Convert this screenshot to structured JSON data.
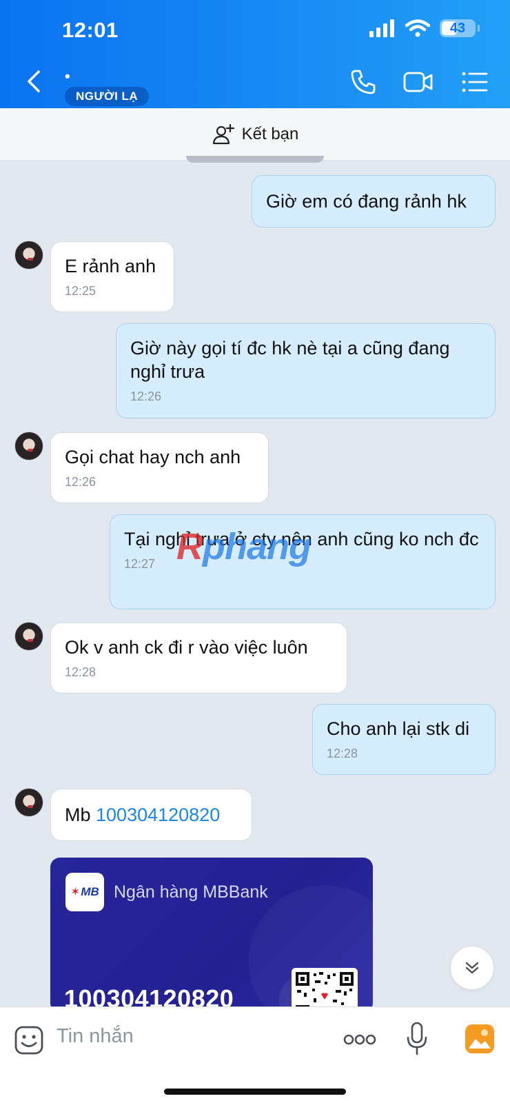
{
  "status_bar": {
    "time": "12:01",
    "battery": "43"
  },
  "header": {
    "contact_name": "•",
    "badge": "NGƯỜI LẠ"
  },
  "add_friend": {
    "label": "Kết bạn"
  },
  "messages": [
    {
      "side": "out",
      "text": "Giờ em có đang rảnh hk",
      "time": ""
    },
    {
      "side": "in",
      "text": "E rảnh anh",
      "time": "12:25"
    },
    {
      "side": "out",
      "text": "Giờ này gọi tí đc hk nè tại a cũng đang nghỉ trưa",
      "time": "12:26"
    },
    {
      "side": "in",
      "text": "Gọi chat hay nch anh",
      "time": "12:26"
    },
    {
      "side": "out",
      "text": "Tại nghỉ trưa ở cty nên anh cũng ko nch đc",
      "time": "12:27"
    },
    {
      "side": "in",
      "text": "Ok v anh ck đi r vào việc luôn",
      "time": "12:28"
    },
    {
      "side": "out",
      "text": "Cho anh lại stk di",
      "time": "12:28"
    },
    {
      "side": "in",
      "prefix": "Mb ",
      "link": "100304120820",
      "time": ""
    }
  ],
  "bank_card": {
    "logo": "MB",
    "bank_name": "Ngân hàng MBBank",
    "account_number": "100304120820"
  },
  "watermark": {
    "text_red": "R",
    "text_blue": "phang"
  },
  "composer": {
    "placeholder": "Tin nhắn"
  },
  "colors": {
    "header": "#0a73f0",
    "outgoing": "#d5edfd",
    "incoming": "#ffffff",
    "background": "#e2e8f0",
    "card": "#27259a"
  },
  "icons": [
    "back-icon",
    "phone-icon",
    "video-icon",
    "list-icon",
    "add-friend-icon",
    "chevron-down-icon",
    "sticker-icon",
    "more-icon",
    "microphone-icon",
    "image-icon"
  ]
}
